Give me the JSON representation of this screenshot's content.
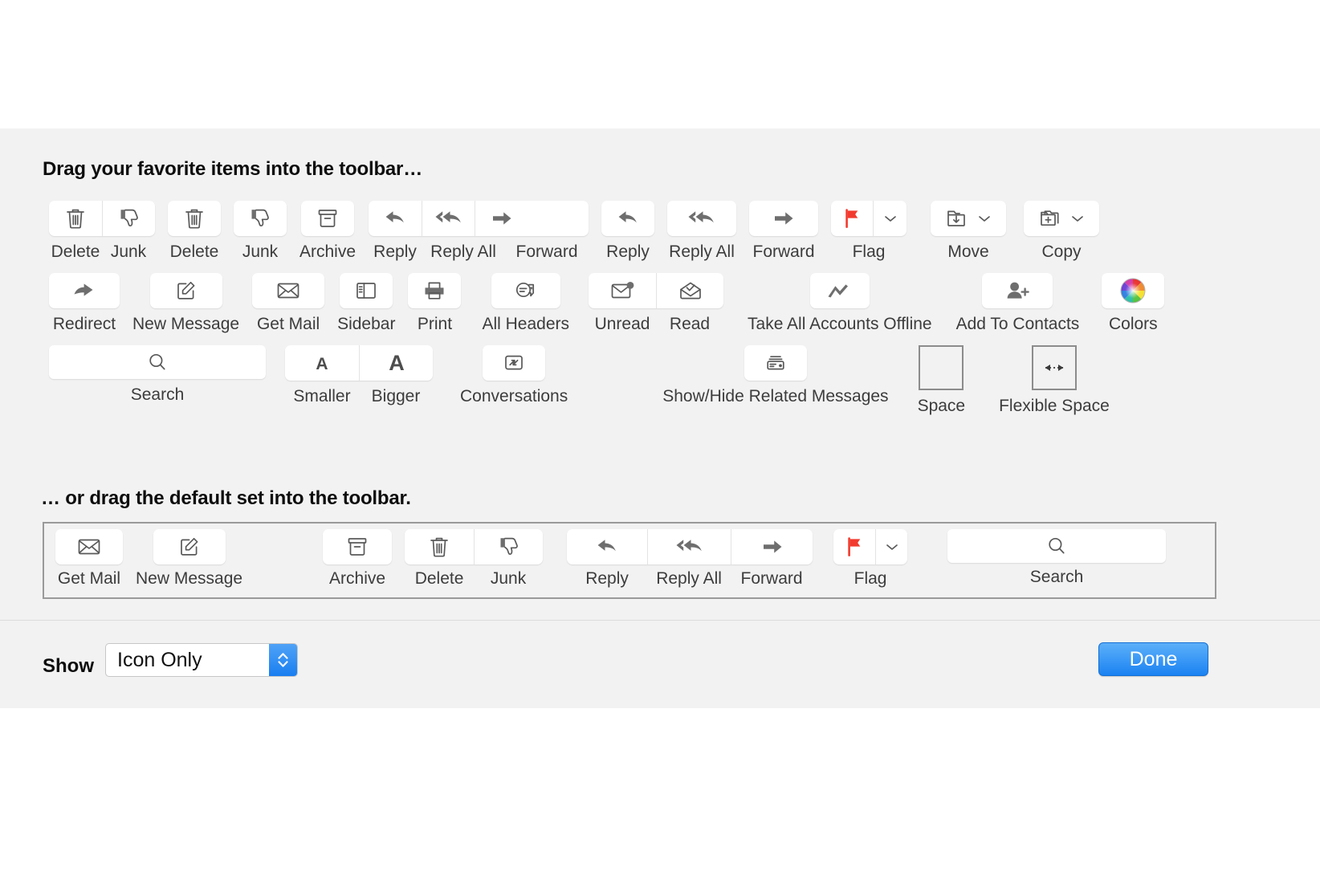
{
  "sheet": {
    "heading_favorites": "Drag your favorite items into the toolbar…",
    "heading_default": "… or drag the default set into the toolbar."
  },
  "palette": {
    "row1": {
      "delete_junk_group": {
        "delete": "Delete",
        "junk": "Junk"
      },
      "delete": "Delete",
      "junk": "Junk",
      "archive": "Archive",
      "reply_group": {
        "reply": "Reply",
        "reply_all": "Reply All",
        "forward": "Forward"
      },
      "reply": "Reply",
      "reply_all": "Reply All",
      "forward": "Forward",
      "flag": "Flag",
      "move": "Move",
      "copy": "Copy"
    },
    "row2": {
      "redirect": "Redirect",
      "new_message": "New Message",
      "get_mail": "Get Mail",
      "sidebar": "Sidebar",
      "print": "Print",
      "all_headers": "All Headers",
      "unread_read_group": {
        "unread": "Unread",
        "read": "Read"
      },
      "take_all_accounts_offline": "Take All Accounts Offline",
      "add_to_contacts": "Add To Contacts",
      "colors": "Colors"
    },
    "row3": {
      "search": "Search",
      "font_size_group": {
        "smaller": "Smaller",
        "bigger": "Bigger"
      },
      "conversations": "Conversations",
      "show_hide_related_messages": "Show/Hide Related Messages",
      "space": "Space",
      "flexible_space": "Flexible Space"
    }
  },
  "default_set": {
    "get_mail": "Get Mail",
    "new_message": "New Message",
    "archive": "Archive",
    "delete_junk_group": {
      "delete": "Delete",
      "junk": "Junk"
    },
    "reply_group": {
      "reply": "Reply",
      "reply_all": "Reply All",
      "forward": "Forward"
    },
    "flag": "Flag",
    "search": "Search"
  },
  "bottom_bar": {
    "show_label": "Show",
    "show_value": "Icon Only",
    "done_label": "Done"
  },
  "colors": {
    "sheet_background": "#f2f2f2",
    "chip_background": "#ffffff",
    "icon_stroke": "#595959",
    "caption_text": "#3c3c3c",
    "heading_text": "#0d0d0d",
    "flag_red": "#f23a2e",
    "accent_blue": "#1b82f2",
    "box_border": "#9a9a9a"
  },
  "icons": {
    "trash": "trash-icon",
    "thumbs_down": "thumbs-down-icon",
    "archive_box": "archive-box-icon",
    "reply_arrow": "reply-arrow-icon",
    "reply_all_arrow": "reply-all-arrow-icon",
    "forward_arrow": "forward-arrow-icon",
    "flag": "flag-icon",
    "chevron_down": "chevron-down-icon",
    "move_folder": "move-to-folder-icon",
    "copy_folder": "copy-to-folder-icon",
    "redirect": "redirect-arrow-icon",
    "compose": "compose-icon",
    "envelope": "envelope-icon",
    "sidebar_panel": "sidebar-panel-icon",
    "printer": "printer-icon",
    "all_headers": "all-headers-icon",
    "unread_envelope": "unread-envelope-icon",
    "read_envelope": "read-envelope-icon",
    "offline": "take-offline-icon",
    "add_contact": "add-contact-icon",
    "color_wheel": "color-wheel-icon",
    "magnifier": "search-icon",
    "letter_a_small": "smaller-text-icon",
    "letter_a_big": "bigger-text-icon",
    "conversations": "conversations-icon",
    "related_messages": "related-messages-icon",
    "flexible_space_arrow": "flexible-space-arrow-icon",
    "stepper_arrows": "stepper-arrows-icon"
  }
}
